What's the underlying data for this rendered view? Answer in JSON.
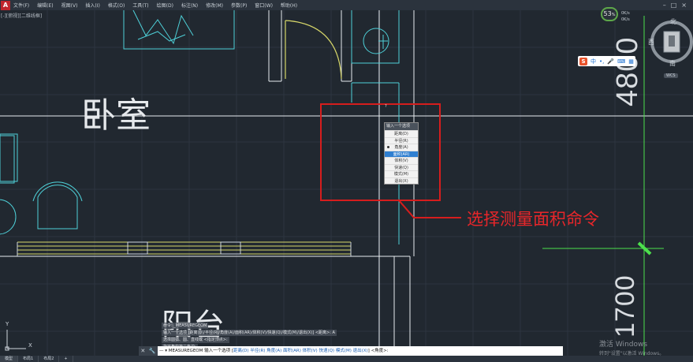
{
  "menu": {
    "app_icon": "A",
    "items": [
      "文件(F)",
      "编辑(E)",
      "视图(V)",
      "插入(I)",
      "格式(O)",
      "工具(T)",
      "绘图(D)",
      "标注(N)",
      "修改(M)",
      "参数(P)",
      "窗口(W)",
      "帮助(H)"
    ],
    "window_controls": [
      "–",
      "□",
      "×"
    ]
  },
  "viewport_label": "[-][俯视][二维线框]",
  "drawing": {
    "room_bedroom": "卧室",
    "room_balcony": "阳台",
    "dim_4800": "4800",
    "dim_1700": "1700",
    "ucs_x": "X",
    "ucs_y": "Y"
  },
  "context_menu": {
    "title": "输入一个选项",
    "cursor_marker": "?",
    "items": [
      {
        "label": "距离(D)",
        "selected": false,
        "checked": false
      },
      {
        "label": "半径(R)",
        "selected": false,
        "checked": false
      },
      {
        "label": "角度(A)",
        "selected": false,
        "checked": true
      },
      {
        "label": "面积(AR)",
        "selected": true,
        "checked": false
      },
      {
        "label": "体积(V)",
        "selected": false,
        "checked": false
      },
      {
        "label": "快速(Q)",
        "selected": false,
        "checked": false
      },
      {
        "label": "模式(M)",
        "selected": false,
        "checked": false
      },
      {
        "label": "退出(X)",
        "selected": false,
        "checked": false
      }
    ]
  },
  "annotation": {
    "text": "选择测量面积命令",
    "color": "#e8262a"
  },
  "viewcube": {
    "north": "北",
    "west": "西",
    "south": "南",
    "wcs": "WCS"
  },
  "zoom_badge": {
    "value": "53",
    "unit": "%",
    "stat1": "0K/s",
    "stat2": "0K/s"
  },
  "ime_bar": {
    "logo": "S",
    "mode": "中",
    "items": [
      "•,",
      "🎤",
      "⌨",
      "▦"
    ]
  },
  "command_history": [
    "命令: _MEASUREGEOM",
    "输入一个选项 [距离(D)/半径(R)/角度(A)/面积(AR)/体积(V)/快速(Q)/模式(M)/退出(X)] <距离>: A",
    "选择圆弧、圆、直线或 <指定顶点>:",
    "指定角的第二条边:"
  ],
  "command_line": {
    "icons": [
      "✕",
      "🔧"
    ],
    "prefix": "— ▾ MEASUREGEOM 输入一个选项 [",
    "options": [
      "距离(D)",
      "半径(R)",
      "角度(A)",
      "面积(AR)",
      "体积(V)",
      "快速(Q)",
      "模式(M)",
      "退出(X)"
    ],
    "suffix": "] <角度>:"
  },
  "layout_tabs": [
    "模型",
    "布局1",
    "布局2",
    "+"
  ],
  "watermark": {
    "line1": "激活 Windows",
    "line2": "转到\"设置\"以激活 Windows。"
  },
  "colors": {
    "background": "#212830",
    "wall": "#ffffff",
    "furniture": "#4ed0d8",
    "window": "#e0e06a",
    "door_arc": "#e0e06a",
    "highlight": "#d61d1d",
    "ucs_green": "#4ce04c"
  }
}
